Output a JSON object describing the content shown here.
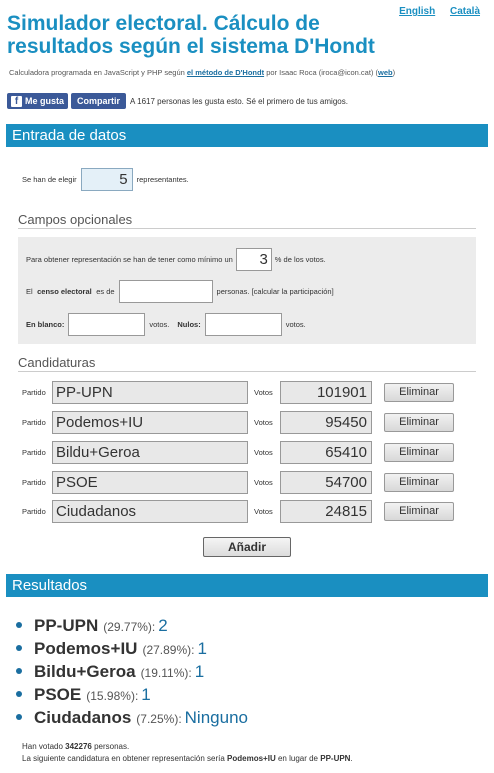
{
  "header": {
    "title": "Simulador electoral. Cálculo de resultados según el sistema D'Hondt",
    "lang_english": "English",
    "lang_catala": "Català",
    "credits_prefix": "Calculadora programada en JavaScript y PHP según",
    "credits_link": "el método de D'Hondt",
    "credits_middle": "por Isaac Roca (iroca@icon.cat) (",
    "credits_web": "web",
    "credits_suffix": ")"
  },
  "social": {
    "like_label": "Me gusta",
    "share_label": "Compartir",
    "like_text": "A 1617 personas les gusta esto. Sé el primero de tus amigos."
  },
  "entrada": {
    "section_title": "Entrada de datos",
    "elect_prefix": "Se han de elegir",
    "elect_value": "5",
    "elect_suffix": "representantes."
  },
  "opcionales": {
    "title": "Campos opcionales",
    "min_prefix": "Para obtener representación se han de tener como mínimo un",
    "min_value": "3",
    "min_suffix": "% de los votos.",
    "censo_pre": "El",
    "censo_bold": "censo electoral",
    "censo_mid": "es de",
    "censo_value": "",
    "censo_suffix": "personas. [calcular la participación]",
    "blanco_label": "En blanco:",
    "blanco_value": "",
    "votos_1": "votos.",
    "nulos_label": "Nulos:",
    "nulos_value": "",
    "votos_2": "votos."
  },
  "candidaturas": {
    "title": "Candidaturas",
    "partido_label": "Partido",
    "votos_label": "Votos",
    "delete_label": "Eliminar",
    "add_label": "Añadir",
    "rows": [
      {
        "name": "PP-UPN",
        "votes": "101901"
      },
      {
        "name": "Podemos+IU",
        "votes": "95450"
      },
      {
        "name": "Bildu+Geroa",
        "votes": "65410"
      },
      {
        "name": "PSOE",
        "votes": "54700"
      },
      {
        "name": "Ciudadanos",
        "votes": "24815"
      }
    ]
  },
  "resultados": {
    "section_title": "Resultados",
    "items": [
      {
        "name": "PP-UPN",
        "pct": "(29.77%):",
        "seats": "2"
      },
      {
        "name": "Podemos+IU",
        "pct": "(27.89%):",
        "seats": "1"
      },
      {
        "name": "Bildu+Geroa",
        "pct": "(19.11%):",
        "seats": "1"
      },
      {
        "name": "PSOE",
        "pct": "(15.98%):",
        "seats": "1"
      },
      {
        "name": "Ciudadanos",
        "pct": "(7.25%):",
        "seats": "Ninguno"
      }
    ],
    "voted_prefix": "Han votado",
    "voted_count": "342276",
    "voted_suffix": "personas.",
    "next_prefix": "La siguiente candidatura en obtener representación sería",
    "next_party": "Podemos+IU",
    "next_middle": "en lugar de",
    "next_replaced": "PP-UPN",
    "next_suffix": "."
  },
  "colors": {
    "accent": "#1a8fc1",
    "facebook": "#3b5998"
  }
}
